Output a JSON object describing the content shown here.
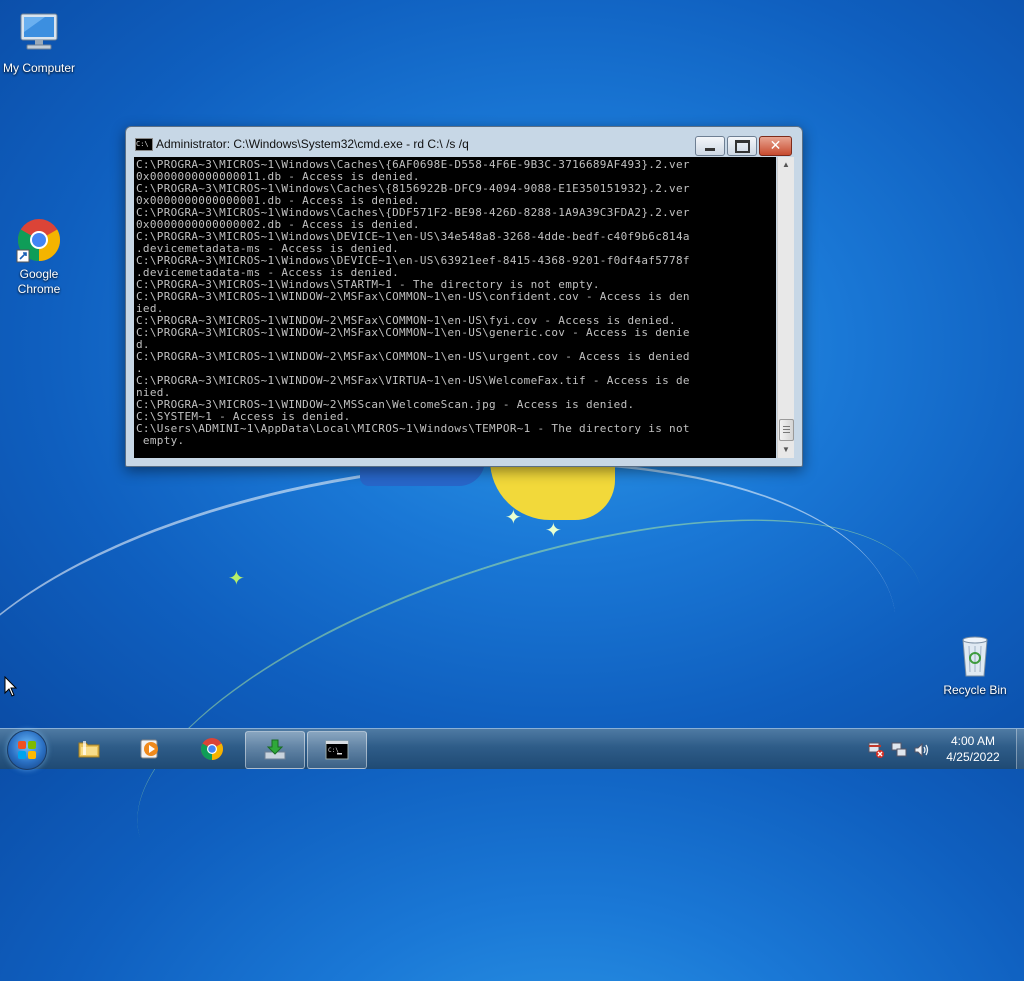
{
  "desktop": {
    "icons": [
      {
        "label": "My Computer",
        "icon": "computer-icon"
      },
      {
        "label": "Google Chrome",
        "icon": "chrome-icon"
      },
      {
        "label": "Recycle Bin",
        "icon": "recycle-bin-icon"
      }
    ]
  },
  "cmd_window": {
    "title": "Administrator: C:\\Windows\\System32\\cmd.exe - rd  C:\\ /s /q",
    "icon_text": "C:\\",
    "console_lines": [
      "C:\\PROGRA~3\\MICROS~1\\Windows\\Caches\\{6AF0698E-D558-4F6E-9B3C-3716689AF493}.2.ver",
      "0x0000000000000011.db - Access is denied.",
      "C:\\PROGRA~3\\MICROS~1\\Windows\\Caches\\{8156922B-DFC9-4094-9088-E1E350151932}.2.ver",
      "0x0000000000000001.db - Access is denied.",
      "C:\\PROGRA~3\\MICROS~1\\Windows\\Caches\\{DDF571F2-BE98-426D-8288-1A9A39C3FDA2}.2.ver",
      "0x0000000000000002.db - Access is denied.",
      "C:\\PROGRA~3\\MICROS~1\\Windows\\DEVICE~1\\en-US\\34e548a8-3268-4dde-bedf-c40f9b6c814a",
      ".devicemetadata-ms - Access is denied.",
      "C:\\PROGRA~3\\MICROS~1\\Windows\\DEVICE~1\\en-US\\63921eef-8415-4368-9201-f0df4af5778f",
      ".devicemetadata-ms - Access is denied.",
      "C:\\PROGRA~3\\MICROS~1\\Windows\\STARTM~1 - The directory is not empty.",
      "C:\\PROGRA~3\\MICROS~1\\WINDOW~2\\MSFax\\COMMON~1\\en-US\\confident.cov - Access is den",
      "ied.",
      "C:\\PROGRA~3\\MICROS~1\\WINDOW~2\\MSFax\\COMMON~1\\en-US\\fyi.cov - Access is denied.",
      "C:\\PROGRA~3\\MICROS~1\\WINDOW~2\\MSFax\\COMMON~1\\en-US\\generic.cov - Access is denie",
      "d.",
      "C:\\PROGRA~3\\MICROS~1\\WINDOW~2\\MSFax\\COMMON~1\\en-US\\urgent.cov - Access is denied",
      ".",
      "C:\\PROGRA~3\\MICROS~1\\WINDOW~2\\MSFax\\VIRTUA~1\\en-US\\WelcomeFax.tif - Access is de",
      "nied.",
      "C:\\PROGRA~3\\MICROS~1\\WINDOW~2\\MSScan\\WelcomeScan.jpg - Access is denied.",
      "C:\\SYSTEM~1 - Access is denied.",
      "C:\\Users\\ADMINI~1\\AppData\\Local\\MICROS~1\\Windows\\TEMPOR~1 - The directory is not",
      " empty."
    ]
  },
  "taskbar": {
    "items": [
      {
        "name": "file-explorer",
        "icon": "folder-icon",
        "active": false
      },
      {
        "name": "media-player",
        "icon": "media-player-icon",
        "active": false
      },
      {
        "name": "chrome",
        "icon": "chrome-icon",
        "active": false
      },
      {
        "name": "installer",
        "icon": "installer-icon",
        "active": true
      },
      {
        "name": "cmd",
        "icon": "cmd-icon",
        "active": true
      }
    ],
    "tray_icons": [
      "network-error-icon",
      "network-icon",
      "volume-icon"
    ],
    "clock_time": "4:00 AM",
    "clock_date": "4/25/2022"
  },
  "colors": {
    "console_bg": "#000000",
    "console_text": "#c0c0c0",
    "close_button": "#c74a2e"
  }
}
